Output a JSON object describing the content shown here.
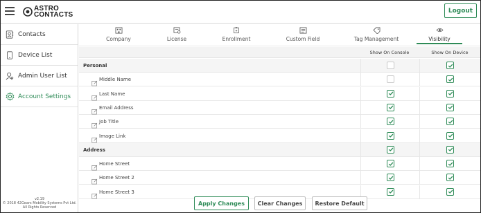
{
  "header": {
    "brand_line1": "ASTRO",
    "brand_line2": "CONTACTS",
    "logout_label": "Logout"
  },
  "sidebar": {
    "items": [
      {
        "label": "Contacts",
        "icon": "contacts-icon"
      },
      {
        "label": "Device List",
        "icon": "device-icon"
      },
      {
        "label": "Admin User List",
        "icon": "admin-user-icon"
      },
      {
        "label": "Account Settings",
        "icon": "gear-icon",
        "active": true
      }
    ],
    "version": "v2.19",
    "copyright": "© 2018 42Gears Mobility Systems Pvt Ltd.",
    "rights": "All Rights Reserved"
  },
  "tabs": [
    {
      "label": "Company",
      "icon": "company-icon"
    },
    {
      "label": "License",
      "icon": "license-icon"
    },
    {
      "label": "Enrollment",
      "icon": "enrollment-icon"
    },
    {
      "label": "Custom Field",
      "icon": "custom-field-icon"
    },
    {
      "label": "Tag Management",
      "icon": "tag-icon"
    },
    {
      "label": "Visibility",
      "icon": "eye-icon",
      "active": true
    }
  ],
  "table": {
    "columns": [
      "Show On Console",
      "Show On Device"
    ],
    "rows": [
      {
        "type": "section",
        "label": "Personal",
        "console": false,
        "device": true
      },
      {
        "type": "field",
        "label": "Middle Name",
        "console": false,
        "device": true
      },
      {
        "type": "field",
        "label": "Last Name",
        "console": true,
        "device": true
      },
      {
        "type": "field",
        "label": "Email Address",
        "console": true,
        "device": true
      },
      {
        "type": "field",
        "label": "Job Title",
        "console": true,
        "device": true
      },
      {
        "type": "field",
        "label": "Image Link",
        "console": true,
        "device": true
      },
      {
        "type": "section",
        "label": "Address",
        "console": true,
        "device": true
      },
      {
        "type": "field",
        "label": "Home Street",
        "console": true,
        "device": true
      },
      {
        "type": "field",
        "label": "Home Street 2",
        "console": true,
        "device": true
      },
      {
        "type": "field",
        "label": "Home Street 3",
        "console": true,
        "device": true
      }
    ]
  },
  "footer": {
    "apply_label": "Apply Changes",
    "clear_label": "Clear Changes",
    "restore_label": "Restore Default"
  },
  "colors": {
    "accent": "#2e8b57"
  }
}
